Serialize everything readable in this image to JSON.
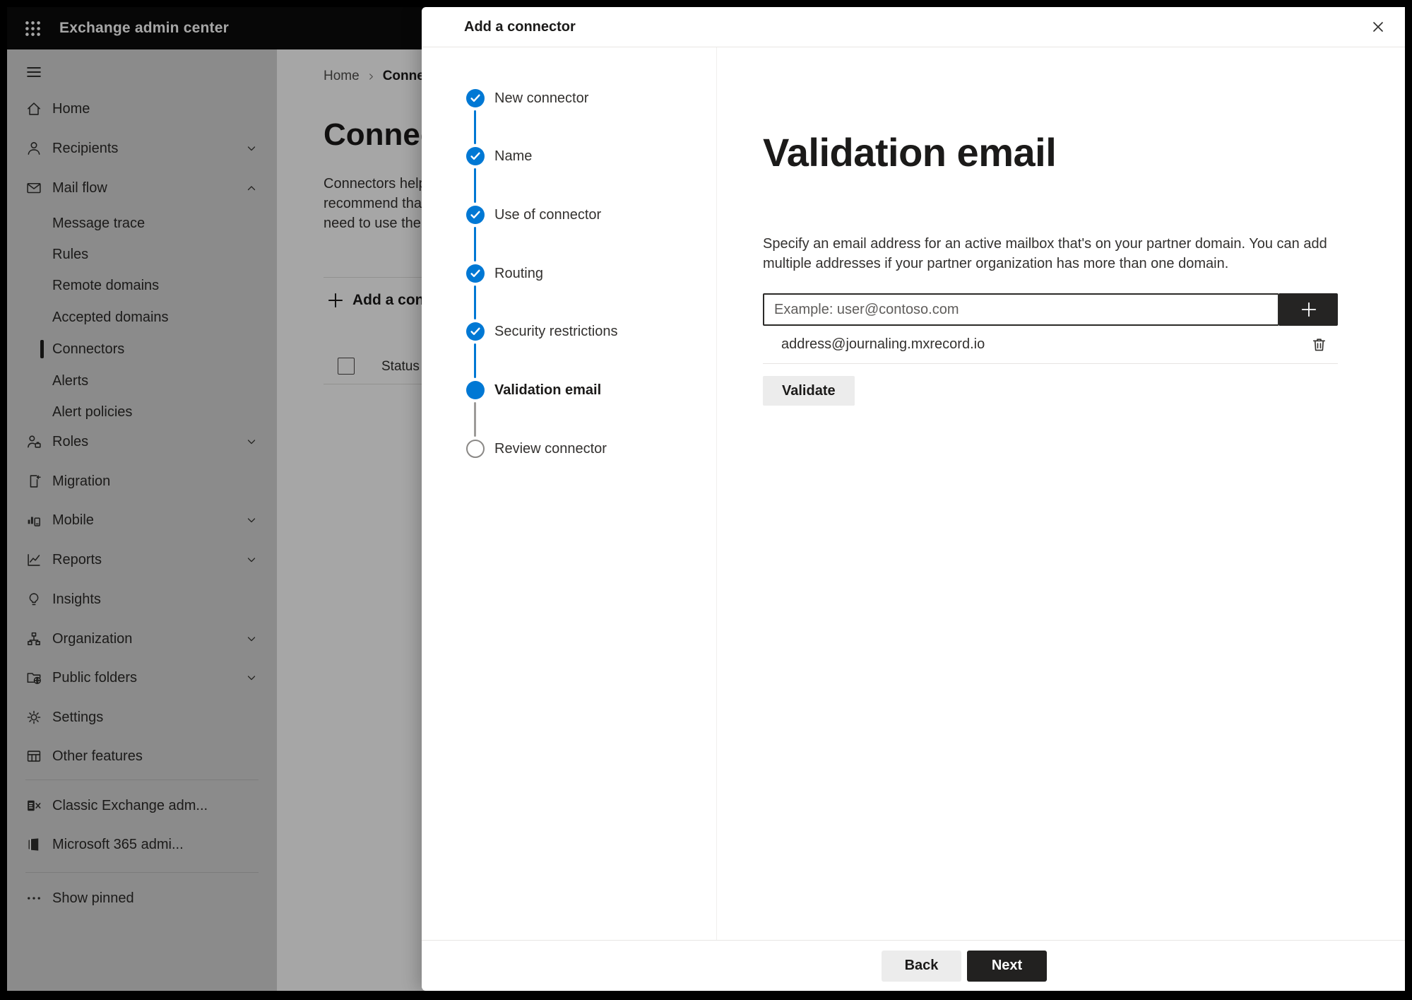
{
  "app": {
    "title": "Exchange admin center"
  },
  "colors": {
    "topbar_bg": "#0b0b0b",
    "accent_blue": "#0078d4",
    "sidebar_bg": "#d6d6d6",
    "overlay": "rgba(0,0,0,0.35)",
    "dark_button_bg": "#252423",
    "light_button_bg": "#ececec",
    "text_primary": "#33312f",
    "text_heading": "#1b1a19",
    "placeholder_text": "#5f5d5b",
    "divider": "#e1dfdd",
    "step_pending_border": "#8a8886",
    "step_pending_line": "#9d9b99"
  },
  "icons": {
    "app-launcher-icon": "3x3 white dot grid",
    "hamburger-icon": "three horizontal lines",
    "home-icon": "house outline",
    "person-icon": "person outline",
    "mail-icon": "envelope outline",
    "roles-icon": "person with briefcase",
    "migration-icon": "document with import arrow",
    "mobile-icon": "bar chart with phone",
    "reports-icon": "line chart",
    "insights-icon": "lightbulb",
    "organization-icon": "org chart nodes",
    "public-folders-icon": "folder with globe",
    "settings-icon": "gear",
    "other-features-icon": "table grid",
    "exchange-logo-icon": "dark square with E and X",
    "m365-logo-icon": "office logo shape",
    "ellipsis-icon": "three dots",
    "chevron-down-icon": "v",
    "chevron-up-icon": "^",
    "chevron-right-icon": ">",
    "check-icon": "white checkmark in blue circle",
    "plus-icon": "+",
    "trash-icon": "trash can outline",
    "close-icon": "x"
  },
  "sidebar": {
    "items": [
      {
        "label": "Home",
        "icon": "home-icon"
      },
      {
        "label": "Recipients",
        "icon": "person-icon",
        "chevron": "down"
      },
      {
        "label": "Mail flow",
        "icon": "mail-icon",
        "chevron": "up",
        "expanded": true
      },
      {
        "label": "Message trace",
        "type": "sub"
      },
      {
        "label": "Rules",
        "type": "sub"
      },
      {
        "label": "Remote domains",
        "type": "sub"
      },
      {
        "label": "Accepted domains",
        "type": "sub"
      },
      {
        "label": "Connectors",
        "type": "sub",
        "selected": true
      },
      {
        "label": "Alerts",
        "type": "sub"
      },
      {
        "label": "Alert policies",
        "type": "sub"
      },
      {
        "label": "Roles",
        "icon": "roles-icon",
        "chevron": "down"
      },
      {
        "label": "Migration",
        "icon": "migration-icon"
      },
      {
        "label": "Mobile",
        "icon": "mobile-icon",
        "chevron": "down"
      },
      {
        "label": "Reports",
        "icon": "reports-icon",
        "chevron": "down"
      },
      {
        "label": "Insights",
        "icon": "insights-icon"
      },
      {
        "label": "Organization",
        "icon": "organization-icon",
        "chevron": "down"
      },
      {
        "label": "Public folders",
        "icon": "public-folders-icon",
        "chevron": "down"
      },
      {
        "label": "Settings",
        "icon": "settings-icon"
      },
      {
        "label": "Other features",
        "icon": "other-features-icon"
      },
      {
        "label": "Classic Exchange adm...",
        "icon": "exchange-logo-icon"
      },
      {
        "label": "Microsoft 365 admi...",
        "icon": "m365-logo-icon"
      },
      {
        "label": "Show pinned",
        "icon": "ellipsis-icon"
      }
    ]
  },
  "page": {
    "breadcrumb": {
      "home": "Home",
      "current": "Connectors"
    },
    "title": "Connectors",
    "description_lines": [
      "Connectors help",
      "recommend that",
      "need to use ther"
    ],
    "add_button_label": "Add a connector",
    "table": {
      "status_header": "Status"
    }
  },
  "modal": {
    "title": "Add a connector",
    "steps": [
      {
        "label": "New connector",
        "state": "complete"
      },
      {
        "label": "Name",
        "state": "complete"
      },
      {
        "label": "Use of connector",
        "state": "complete"
      },
      {
        "label": "Routing",
        "state": "complete"
      },
      {
        "label": "Security restrictions",
        "state": "complete"
      },
      {
        "label": "Validation email",
        "state": "active"
      },
      {
        "label": "Review connector",
        "state": "upcoming"
      }
    ],
    "content": {
      "heading": "Validation email",
      "description": "Specify an email address for an active mailbox that's on your partner domain. You can add multiple addresses if your partner organization has more than one domain.",
      "email_input": {
        "value": "",
        "placeholder": "Example: user@contoso.com"
      },
      "emails": [
        {
          "address": "address@journaling.mxrecord.io"
        }
      ],
      "validate_button_label": "Validate"
    },
    "footer": {
      "back_label": "Back",
      "next_label": "Next"
    }
  }
}
